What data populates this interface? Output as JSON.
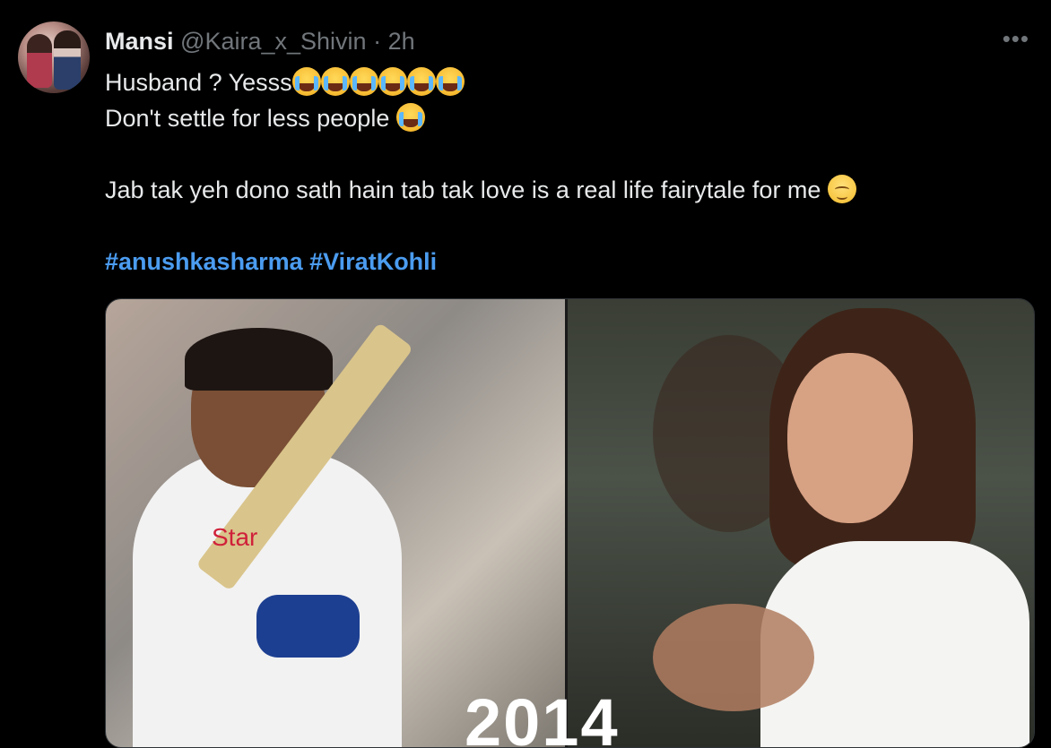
{
  "author": {
    "name": "Mansi",
    "handle": "@Kaira_x_Shivin",
    "separator": "·",
    "time": "2h"
  },
  "more_label": "•••",
  "tweet": {
    "line1": "Husband ? Yesss",
    "line1_emoji": [
      "loudly-crying-face",
      "loudly-crying-face",
      "loudly-crying-face",
      "loudly-crying-face",
      "loudly-crying-face",
      "loudly-crying-face"
    ],
    "line2": "Don't settle for less people ",
    "line2_emoji": "loudly-crying-face",
    "line3": "Jab tak yeh dono sath hain tab tak love is a real life fairytale for me ",
    "line3_emoji": "relieved-face",
    "hashtags": [
      "#anushkasharma",
      "#ViratKohli"
    ]
  },
  "media": {
    "left_label": "Star",
    "year_text": "2014"
  }
}
